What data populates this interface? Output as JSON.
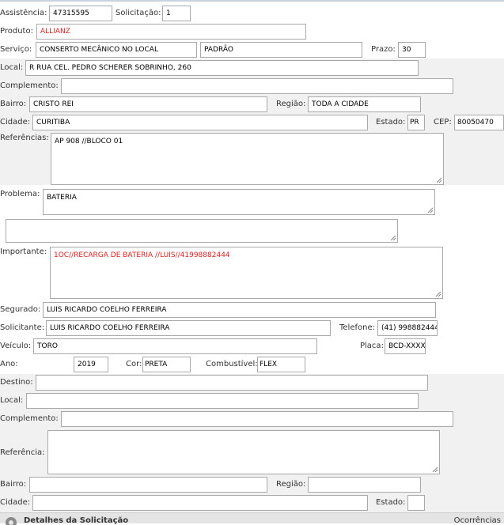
{
  "assistencia": {
    "label": "Assistência:",
    "value": "47315595"
  },
  "solicitacao": {
    "label": "Solicitação:",
    "value": "1"
  },
  "produto": {
    "label": "Produto:",
    "value": "ALLIANZ"
  },
  "servico": {
    "label": "Serviço:",
    "value": "CONSERTO MECÂNICO NO LOCAL",
    "value2": "PADRÃO"
  },
  "prazo": {
    "label": "Prazo:",
    "value": "30"
  },
  "local": {
    "label": "Local:",
    "value": "R RUA CEL. PEDRO SCHERER SOBRINHO, 260"
  },
  "complemento": {
    "label": "Complemento:",
    "value": ""
  },
  "bairro": {
    "label": "Bairro:",
    "value": "CRISTO REI"
  },
  "regiao": {
    "label": "Região:",
    "value": "TODA A CIDADE"
  },
  "cidade": {
    "label": "Cidade:",
    "value": "CURITIBA"
  },
  "estado": {
    "label": "Estado:",
    "value": "PR"
  },
  "cep": {
    "label": "CEP:",
    "value": "80050470"
  },
  "referencias": {
    "label": "Referências:",
    "value": "AP 908 //BLOCO 01"
  },
  "problema": {
    "label": "Problema:",
    "value": "BATERIA",
    "extra": ""
  },
  "importante": {
    "label": "Importante:",
    "value": "1OC//RECARGA DE BATERIA //LUIS//41998882444"
  },
  "segurado": {
    "label": "Segurado:",
    "value": "LUIS RICARDO COELHO FERREIRA"
  },
  "solicitante": {
    "label": "Solicitante:",
    "value": "LUIS RICARDO COELHO FERREIRA"
  },
  "telefone": {
    "label": "Telefone:",
    "value": "(41) 998882444"
  },
  "veiculo": {
    "label": "Veículo:",
    "value": "TORO"
  },
  "placa": {
    "label": "Placa:",
    "value": "BCD-XXXX"
  },
  "ano": {
    "label": "Ano:",
    "value": "2019"
  },
  "cor": {
    "label": "Cor:",
    "value": "PRETA"
  },
  "combustivel": {
    "label": "Combustível:",
    "value": "FLEX"
  },
  "destino": {
    "destino": {
      "label": "Destino:",
      "value": ""
    },
    "local": {
      "label": "Local:",
      "value": ""
    },
    "complemento": {
      "label": "Complemento:",
      "value": ""
    },
    "referencia": {
      "label": "Referência:",
      "value": ""
    },
    "bairro": {
      "label": "Bairro:",
      "value": ""
    },
    "regiao": {
      "label": "Região:",
      "value": ""
    },
    "cidade": {
      "label": "Cidade:",
      "value": ""
    },
    "estado": {
      "label": "Estado:",
      "value": ""
    }
  },
  "footer": {
    "title": "Detalhes da Solicitação",
    "right": "Ocorrências",
    "icon": "gear-icon"
  },
  "colors": {
    "band": "#f1f1f1",
    "red_value": "#e02020",
    "border": "#a9a9a9"
  }
}
